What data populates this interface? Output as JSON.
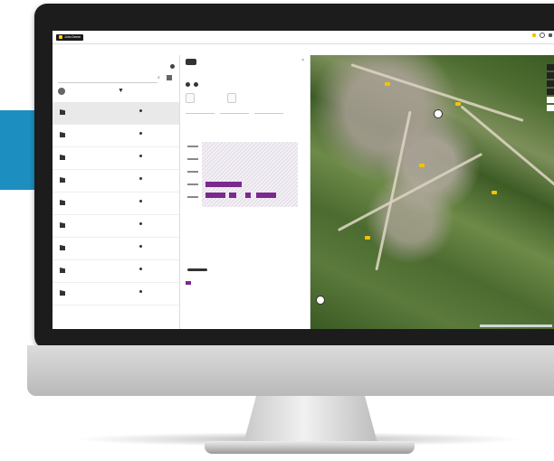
{
  "app": {
    "logo_text": "John Deere",
    "badge": "",
    "user_line1": "",
    "user_line2": ""
  },
  "nav": [
    "",
    "",
    "",
    ""
  ],
  "left_panel": {
    "header": "",
    "subheader": "",
    "search_placeholder": "",
    "filter_chip": "",
    "machines": [
      {
        "title": "",
        "subtitle": "",
        "status": ""
      },
      {
        "title": "",
        "subtitle": "",
        "status": ""
      },
      {
        "title": "",
        "subtitle": "",
        "status": ""
      },
      {
        "title": "",
        "subtitle": "",
        "status": ""
      },
      {
        "title": "",
        "subtitle": "",
        "status": ""
      },
      {
        "title": "",
        "subtitle": "",
        "status": ""
      },
      {
        "title": "",
        "subtitle": "",
        "status": ""
      },
      {
        "title": "",
        "subtitle": "",
        "status": ""
      },
      {
        "title": "",
        "subtitle": "",
        "status": ""
      }
    ]
  },
  "detail_panel": {
    "title": "",
    "subtitle": "",
    "meta": "",
    "button_left": "",
    "button_right": "",
    "tabs": [
      "",
      "",
      "",
      ""
    ],
    "chart_title": "",
    "chart_link": "",
    "toggle_label": "",
    "legend_label": "",
    "notes_title": "",
    "notes_body": ""
  },
  "colors": {
    "accent": "#1c8fc0",
    "brand_green": "#367c2b",
    "brand_yellow": "#ffde00",
    "usage_bar": "#7a2a8c"
  }
}
